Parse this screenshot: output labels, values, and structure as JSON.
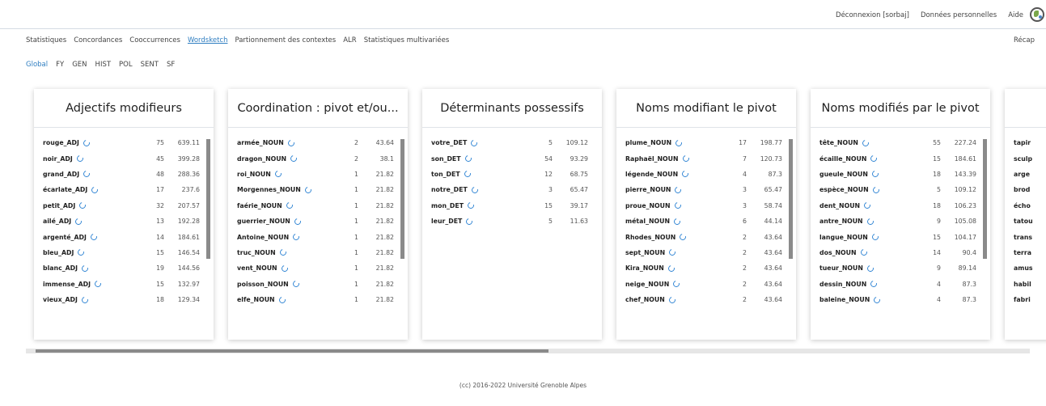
{
  "header": {
    "links": [
      "Déconnexion [sorbaj]",
      "Données personnelles",
      "Aide"
    ],
    "globe_icon": "globe-icon"
  },
  "nav": {
    "items": [
      "Statistiques",
      "Concordances",
      "Cooccurrences",
      "Wordsketch",
      "Partionnement des contextes",
      "ALR",
      "Statistiques multivariées"
    ],
    "active": "Wordsketch",
    "recap": "Récap"
  },
  "subnav": {
    "items": [
      "Global",
      "FY",
      "GEN",
      "HIST",
      "POL",
      "SENT",
      "SF"
    ],
    "active": "Global"
  },
  "panels": [
    {
      "title": "Adjectifs modifieurs",
      "rows": [
        {
          "word": "rouge_ADJ",
          "count": "75",
          "score": "639.11"
        },
        {
          "word": "noir_ADJ",
          "count": "45",
          "score": "399.28"
        },
        {
          "word": "grand_ADJ",
          "count": "48",
          "score": "288.36"
        },
        {
          "word": "écarlate_ADJ",
          "count": "17",
          "score": "237.6"
        },
        {
          "word": "petit_ADJ",
          "count": "32",
          "score": "207.57"
        },
        {
          "word": "ailé_ADJ",
          "count": "13",
          "score": "192.28"
        },
        {
          "word": "argenté_ADJ",
          "count": "14",
          "score": "184.61"
        },
        {
          "word": "bleu_ADJ",
          "count": "15",
          "score": "146.54"
        },
        {
          "word": "blanc_ADJ",
          "count": "19",
          "score": "144.56"
        },
        {
          "word": "immense_ADJ",
          "count": "15",
          "score": "132.97"
        },
        {
          "word": "vieux_ADJ",
          "count": "18",
          "score": "129.34"
        }
      ]
    },
    {
      "title": "Coordination : pivot et/ou...",
      "rows": [
        {
          "word": "armée_NOUN",
          "count": "2",
          "score": "43.64"
        },
        {
          "word": "dragon_NOUN",
          "count": "2",
          "score": "38.1"
        },
        {
          "word": "roi_NOUN",
          "count": "1",
          "score": "21.82"
        },
        {
          "word": "Morgennes_NOUN",
          "count": "1",
          "score": "21.82"
        },
        {
          "word": "faérie_NOUN",
          "count": "1",
          "score": "21.82"
        },
        {
          "word": "guerrier_NOUN",
          "count": "1",
          "score": "21.82"
        },
        {
          "word": "Antoine_NOUN",
          "count": "1",
          "score": "21.82"
        },
        {
          "word": "truc_NOUN",
          "count": "1",
          "score": "21.82"
        },
        {
          "word": "vent_NOUN",
          "count": "1",
          "score": "21.82"
        },
        {
          "word": "poisson_NOUN",
          "count": "1",
          "score": "21.82"
        },
        {
          "word": "elfe_NOUN",
          "count": "1",
          "score": "21.82"
        }
      ]
    },
    {
      "title": "Déterminants possessifs",
      "rows": [
        {
          "word": "votre_DET",
          "count": "5",
          "score": "109.12"
        },
        {
          "word": "son_DET",
          "count": "54",
          "score": "93.29"
        },
        {
          "word": "ton_DET",
          "count": "12",
          "score": "68.75"
        },
        {
          "word": "notre_DET",
          "count": "3",
          "score": "65.47"
        },
        {
          "word": "mon_DET",
          "count": "15",
          "score": "39.17"
        },
        {
          "word": "leur_DET",
          "count": "5",
          "score": "11.63"
        }
      ]
    },
    {
      "title": "Noms modifiant le pivot",
      "rows": [
        {
          "word": "plume_NOUN",
          "count": "17",
          "score": "198.77"
        },
        {
          "word": "Raphaël_NOUN",
          "count": "7",
          "score": "120.73"
        },
        {
          "word": "légende_NOUN",
          "count": "4",
          "score": "87.3"
        },
        {
          "word": "pierre_NOUN",
          "count": "3",
          "score": "65.47"
        },
        {
          "word": "proue_NOUN",
          "count": "3",
          "score": "58.74"
        },
        {
          "word": "métal_NOUN",
          "count": "6",
          "score": "44.14"
        },
        {
          "word": "Rhodes_NOUN",
          "count": "2",
          "score": "43.64"
        },
        {
          "word": "sept_NOUN",
          "count": "2",
          "score": "43.64"
        },
        {
          "word": "Kira_NOUN",
          "count": "2",
          "score": "43.64"
        },
        {
          "word": "neige_NOUN",
          "count": "2",
          "score": "43.64"
        },
        {
          "word": "chef_NOUN",
          "count": "2",
          "score": "43.64"
        }
      ]
    },
    {
      "title": "Noms modifiés par le pivot",
      "rows": [
        {
          "word": "tête_NOUN",
          "count": "55",
          "score": "227.24"
        },
        {
          "word": "écaille_NOUN",
          "count": "15",
          "score": "184.61"
        },
        {
          "word": "gueule_NOUN",
          "count": "18",
          "score": "143.39"
        },
        {
          "word": "espèce_NOUN",
          "count": "5",
          "score": "109.12"
        },
        {
          "word": "dent_NOUN",
          "count": "18",
          "score": "106.23"
        },
        {
          "word": "antre_NOUN",
          "count": "9",
          "score": "105.08"
        },
        {
          "word": "langue_NOUN",
          "count": "15",
          "score": "104.17"
        },
        {
          "word": "dos_NOUN",
          "count": "14",
          "score": "90.4"
        },
        {
          "word": "tueur_NOUN",
          "count": "9",
          "score": "89.14"
        },
        {
          "word": "dessin_NOUN",
          "count": "4",
          "score": "87.3"
        },
        {
          "word": "baleine_NOUN",
          "count": "4",
          "score": "87.3"
        }
      ]
    },
    {
      "title": "",
      "rows": [
        {
          "word": "tapir"
        },
        {
          "word": "sculp"
        },
        {
          "word": "arge"
        },
        {
          "word": "brod"
        },
        {
          "word": "écho"
        },
        {
          "word": "tatou"
        },
        {
          "word": "trans"
        },
        {
          "word": "terra"
        },
        {
          "word": "amus"
        },
        {
          "word": "habil"
        },
        {
          "word": "fabri"
        }
      ]
    }
  ],
  "footer": "(cc) 2016-2022 Université Grenoble Alpes",
  "colors": {
    "accent": "#2f7ec1",
    "scrollbar": "#8a8a8a"
  }
}
